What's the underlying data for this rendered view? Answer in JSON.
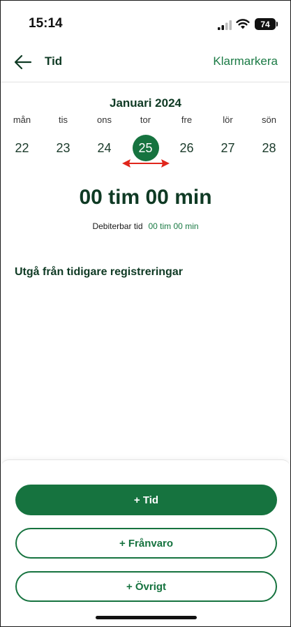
{
  "status_bar": {
    "time": "15:14",
    "battery": "74"
  },
  "header": {
    "title": "Tid",
    "action": "Klarmarkera"
  },
  "calendar": {
    "month": "Januari 2024",
    "days": [
      {
        "name": "mån",
        "num": "22"
      },
      {
        "name": "tis",
        "num": "23"
      },
      {
        "name": "ons",
        "num": "24"
      },
      {
        "name": "tor",
        "num": "25"
      },
      {
        "name": "fre",
        "num": "26"
      },
      {
        "name": "lör",
        "num": "27"
      },
      {
        "name": "sön",
        "num": "28"
      }
    ],
    "selected_index": 3
  },
  "summary": {
    "total": "00 tim 00 min",
    "billable_label": "Debiterbar tid",
    "billable_value": "00 tim 00 min"
  },
  "previous": {
    "heading": "Utgå från tidigare registreringar"
  },
  "actions": {
    "time": "+ Tid",
    "absence": "+ Frånvaro",
    "other": "+ Övrigt"
  },
  "colors": {
    "accent": "#16733f",
    "text_dark": "#0f3a24",
    "annotation_arrow": "#e0261b"
  }
}
